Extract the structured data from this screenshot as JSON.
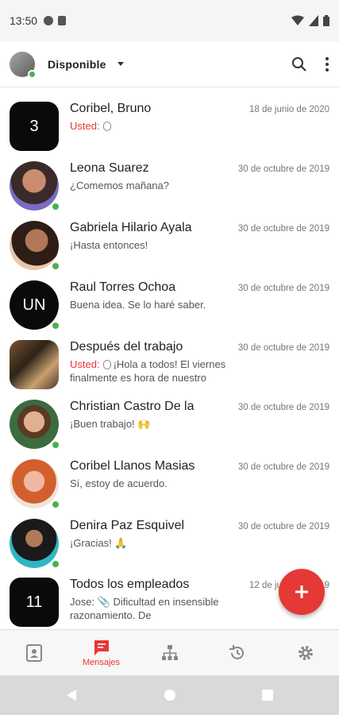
{
  "status_bar": {
    "time": "13:50"
  },
  "header": {
    "presence": "Disponible"
  },
  "conversations": [
    {
      "name": "Coribel, Bruno",
      "date": "18 de junio de 2020",
      "you_label": "Usted:",
      "preview": "",
      "avatar_text": "3",
      "avatar_shape": "square",
      "online": false,
      "attachment": true
    },
    {
      "name": "Leona Suarez",
      "date": "30 de octubre de 2019",
      "preview": "¿Comemos mañana?",
      "avatar_text": "",
      "avatar_shape": "photo",
      "online": true
    },
    {
      "name": "Gabriela Hilario Ayala",
      "date": "30 de octubre de 2019",
      "preview": "¡Hasta entonces!",
      "avatar_text": "",
      "avatar_shape": "photo",
      "online": true
    },
    {
      "name": "Raul Torres Ochoa",
      "date": "30 de octubre de 2019",
      "preview": "Buena idea. Se lo haré saber.",
      "avatar_text": "UN",
      "avatar_shape": "circle",
      "online": true
    },
    {
      "name": "Después del trabajo",
      "date": "30 de octubre de 2019",
      "you_label": "Usted:",
      "preview": "¡Hola a todos! El viernes finalmente es hora de nuestro",
      "avatar_text": "",
      "avatar_shape": "photo",
      "online": false,
      "attachment": true
    },
    {
      "name": "Christian Castro De la",
      "date": "30 de octubre de 2019",
      "preview": "¡Buen trabajo! 🙌",
      "avatar_text": "",
      "avatar_shape": "photo",
      "online": true
    },
    {
      "name": "Coribel Llanos Masias",
      "date": "30 de octubre de 2019",
      "preview": "Sí, estoy de acuerdo.",
      "avatar_text": "",
      "avatar_shape": "photo",
      "online": true
    },
    {
      "name": "Denira Paz Esquivel",
      "date": "30 de octubre de 2019",
      "preview": "¡Gracias! 🙏",
      "avatar_text": "",
      "avatar_shape": "photo",
      "online": true
    },
    {
      "name": "Todos los empleados",
      "date": "12 de junio de 2019",
      "preview": "Jose: 📎 Dificultad en insensible razonamiento. De",
      "avatar_text": "11",
      "avatar_shape": "square",
      "online": false
    }
  ],
  "bottom_nav": {
    "active_label": "Mensajes"
  },
  "icons": [
    "search-icon",
    "more-vert-icon",
    "contacts-icon",
    "messages-icon",
    "org-chart-icon",
    "history-icon",
    "settings-icon",
    "add-icon"
  ],
  "colors": {
    "accent": "#e53935",
    "online": "#4caf50"
  }
}
